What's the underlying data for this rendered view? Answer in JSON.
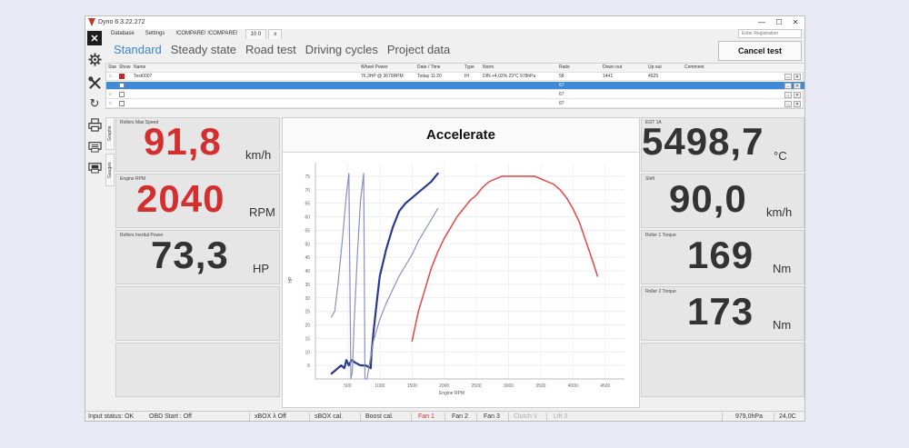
{
  "app": {
    "title": "Dyno 6.3.22.272"
  },
  "menu": {
    "items": [
      "Database",
      "Settings",
      "!COMPARE! !COMPARE!"
    ],
    "tab_label": "10 0",
    "tab_close": "x"
  },
  "registration": {
    "placeholder": "Enter Registration"
  },
  "window_controls": {
    "minimize": "—",
    "maximize": "☐",
    "close": "✕"
  },
  "tabs": [
    "Standard",
    "Steady state",
    "Road test",
    "Driving cycles",
    "Project data"
  ],
  "cancel_button": "Cancel test",
  "grid": {
    "columns": [
      "Star",
      "Show",
      "Name",
      "Wheel Power",
      "Date / Time",
      "Type",
      "Norm",
      "Ratio",
      "Down out",
      "Up out",
      "Comment"
    ],
    "rows": [
      {
        "star": "☆",
        "show": true,
        "name": "Test0007",
        "wheel_power": "76,3HP @ 3679RPM",
        "date": "Today 11:20",
        "type": "IH",
        "norm": "DIN +4,02% 23°C 978hPa",
        "ratio": "58",
        "down": "1441",
        "up": "4525",
        "selected": false
      },
      {
        "star": "",
        "show": false,
        "name": "",
        "wheel_power": "",
        "date": "",
        "type": "",
        "norm": "",
        "ratio": "67",
        "down": "",
        "up": "",
        "selected": true
      },
      {
        "star": "☆",
        "show": false,
        "name": "",
        "wheel_power": "",
        "date": "",
        "type": "",
        "norm": "",
        "ratio": "67",
        "down": "",
        "up": "",
        "selected": false
      },
      {
        "star": "☆",
        "show": false,
        "name": "",
        "wheel_power": "",
        "date": "",
        "type": "",
        "norm": "",
        "ratio": "67",
        "down": "",
        "up": "",
        "selected": false
      }
    ],
    "row_buttons": [
      "↔",
      "✕"
    ]
  },
  "side_tabs": [
    "Graphs",
    "Gauges"
  ],
  "gauges_left": [
    {
      "label": "Rollers Max Speed",
      "value": "91,8",
      "unit": "km/h",
      "color": "#d32f2f"
    },
    {
      "label": "Engine RPM",
      "value": "2040",
      "unit": "RPM",
      "color": "#d32f2f"
    },
    {
      "label": "Rollers Inertial Power",
      "value": "73,3",
      "unit": "HP",
      "color": "#333333"
    }
  ],
  "gauges_right": [
    {
      "label": "EGT 1A",
      "value": "5498,7",
      "unit": "°C"
    },
    {
      "label": "Shift",
      "value": "90,0",
      "unit": "km/h"
    },
    {
      "label": "Roller 1 Torque",
      "value": "169",
      "unit": "Nm"
    },
    {
      "label": "Roller 2 Torque",
      "value": "173",
      "unit": "Nm"
    }
  ],
  "chart_data": {
    "type": "line",
    "title": "Accelerate",
    "xlabel": "Engine RPM",
    "ylabel": "HP",
    "xlim": [
      0,
      4800
    ],
    "ylim": [
      0,
      80
    ],
    "x_ticks": [
      500,
      1000,
      1500,
      2000,
      2500,
      3000,
      3500,
      4000,
      4500
    ],
    "y_ticks": [
      5,
      10,
      15,
      20,
      25,
      30,
      35,
      40,
      45,
      50,
      55,
      60,
      65,
      70,
      75
    ],
    "grid": true,
    "series": [
      {
        "color": "#2b3a8f",
        "width": 2.2,
        "points": [
          [
            250,
            2
          ],
          [
            300,
            3
          ],
          [
            350,
            4
          ],
          [
            400,
            5
          ],
          [
            450,
            4
          ],
          [
            480,
            7
          ],
          [
            520,
            5
          ],
          [
            560,
            7
          ],
          [
            620,
            6
          ],
          [
            700,
            5
          ],
          [
            780,
            5
          ],
          [
            860,
            4
          ],
          [
            870,
            9
          ],
          [
            900,
            17
          ],
          [
            960,
            30
          ],
          [
            1000,
            38
          ],
          [
            1100,
            48
          ],
          [
            1200,
            56
          ],
          [
            1300,
            62
          ],
          [
            1400,
            65
          ],
          [
            1500,
            67
          ],
          [
            1600,
            69
          ],
          [
            1700,
            71
          ],
          [
            1800,
            73
          ],
          [
            1900,
            76
          ]
        ]
      },
      {
        "color": "#8890c0",
        "width": 1.2,
        "points": [
          [
            250,
            23
          ],
          [
            300,
            25
          ],
          [
            350,
            35
          ],
          [
            420,
            52
          ],
          [
            480,
            68
          ],
          [
            520,
            76
          ],
          [
            550,
            0
          ],
          [
            575,
            3
          ],
          [
            600,
            20
          ],
          [
            650,
            45
          ],
          [
            700,
            66
          ],
          [
            750,
            76
          ],
          [
            770,
            0
          ],
          [
            800,
            0
          ],
          [
            900,
            14
          ],
          [
            1000,
            22
          ],
          [
            1100,
            28
          ],
          [
            1200,
            33
          ],
          [
            1300,
            38
          ],
          [
            1400,
            42
          ],
          [
            1500,
            46
          ],
          [
            1600,
            51
          ],
          [
            1700,
            55
          ],
          [
            1800,
            59
          ],
          [
            1900,
            63
          ]
        ]
      },
      {
        "color": "#e05050",
        "width": 1.6,
        "points": [
          [
            1500,
            14
          ],
          [
            1600,
            25
          ],
          [
            1700,
            33
          ],
          [
            1800,
            41
          ],
          [
            1900,
            47
          ],
          [
            2000,
            52
          ],
          [
            2100,
            56
          ],
          [
            2200,
            60
          ],
          [
            2300,
            63
          ],
          [
            2400,
            66
          ],
          [
            2500,
            68
          ],
          [
            2600,
            71
          ],
          [
            2700,
            73
          ],
          [
            2800,
            74
          ],
          [
            2900,
            75
          ],
          [
            3000,
            75
          ],
          [
            3100,
            75
          ],
          [
            3200,
            75
          ],
          [
            3300,
            75
          ],
          [
            3400,
            75
          ],
          [
            3500,
            74
          ],
          [
            3600,
            73
          ],
          [
            3700,
            72
          ],
          [
            3800,
            70
          ],
          [
            3900,
            67
          ],
          [
            4000,
            63
          ],
          [
            4100,
            58
          ],
          [
            4200,
            51
          ],
          [
            4300,
            44
          ],
          [
            4380,
            38
          ]
        ]
      }
    ]
  },
  "statusbar": {
    "input_status": "Input status: OK",
    "obd_start": "OBD Start : Off",
    "xbox": "xBOX λ Off",
    "sbox": "sBOX cal.",
    "boost": "Boost cal.",
    "fan1": "Fan 1",
    "fan2": "Fan 2",
    "fan3": "Fan 3",
    "clutch": "Clutch V",
    "lift": "Lift 3",
    "pressure": "979,0hPa",
    "temp": "24,0C",
    "fan1_color": "#d32f2f",
    "disabled_color": "#aaaaaa"
  }
}
